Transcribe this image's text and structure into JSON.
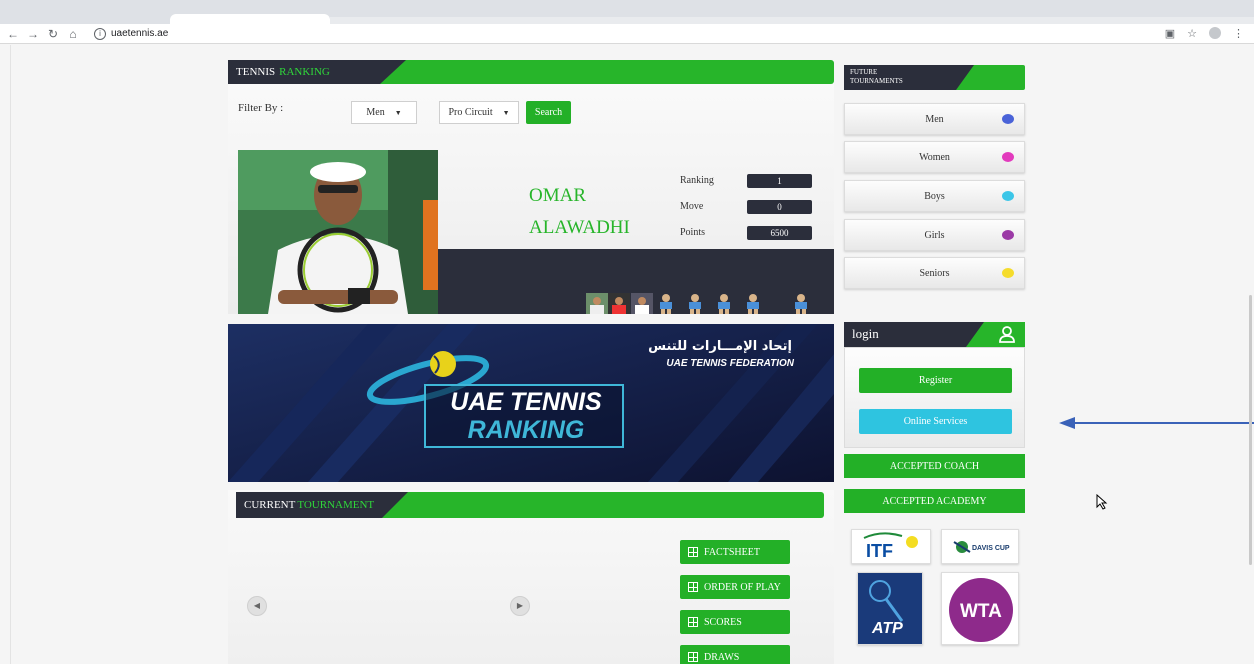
{
  "browser": {
    "url": "uaetennis.ae",
    "back_icon": "arrow-left-icon",
    "forward_icon": "arrow-right-icon",
    "reload_icon": "reload-icon",
    "home_icon": "home-icon",
    "info_icon": "info-icon"
  },
  "ranking": {
    "title_part1": "TENNIS",
    "title_part2": "RANKING",
    "filter_label": "Filter By :",
    "gender_select": "Men",
    "circuit_select": "Pro Circuit",
    "search_label": "Search",
    "player_first": "OMAR",
    "player_last": "ALAWADHI",
    "stats": [
      {
        "label": "Ranking",
        "value": "1"
      },
      {
        "label": "Move",
        "value": "0"
      },
      {
        "label": "Points",
        "value": "6500"
      }
    ]
  },
  "banner": {
    "arabic": "إتحاد الإمـــارات للتنس",
    "federation": "UAE TENNIS FEDERATION",
    "line1": "UAE TENNIS",
    "line2": "RANKING"
  },
  "current": {
    "title_part1": "CURRENT",
    "title_part2": "TOURNAMENT",
    "prev_icon": "chevron-left-icon",
    "next_icon": "chevron-right-icon",
    "buttons": [
      "FACTSHEET",
      "ORDER OF PLAY",
      "SCORES",
      "DRAWS"
    ]
  },
  "future": {
    "title_line1": "FUTURE",
    "title_line2": "TOURNAMENTS",
    "categories": [
      {
        "label": "Men",
        "color": "#4a63d8"
      },
      {
        "label": "Women",
        "color": "#e23bbd"
      },
      {
        "label": "Boys",
        "color": "#3cc6e8"
      },
      {
        "label": "Girls",
        "color": "#9b3aa6"
      },
      {
        "label": "Seniors",
        "color": "#f5dc2c"
      }
    ]
  },
  "login": {
    "title": "login",
    "register": "Register",
    "online_services": "Online Services",
    "accepted_coach": "ACCEPTED COACH",
    "accepted_academy": "ACCEPTED ACADEMY"
  },
  "logos": {
    "itf": "ITF",
    "davis": "DAVIS CUP",
    "atp": "ATP",
    "wta": "WTA"
  },
  "colors": {
    "green": "#27b52a",
    "dark": "#2b2e3b",
    "cyan": "#2ec4e0",
    "annotation_blue": "#3a62b8"
  }
}
